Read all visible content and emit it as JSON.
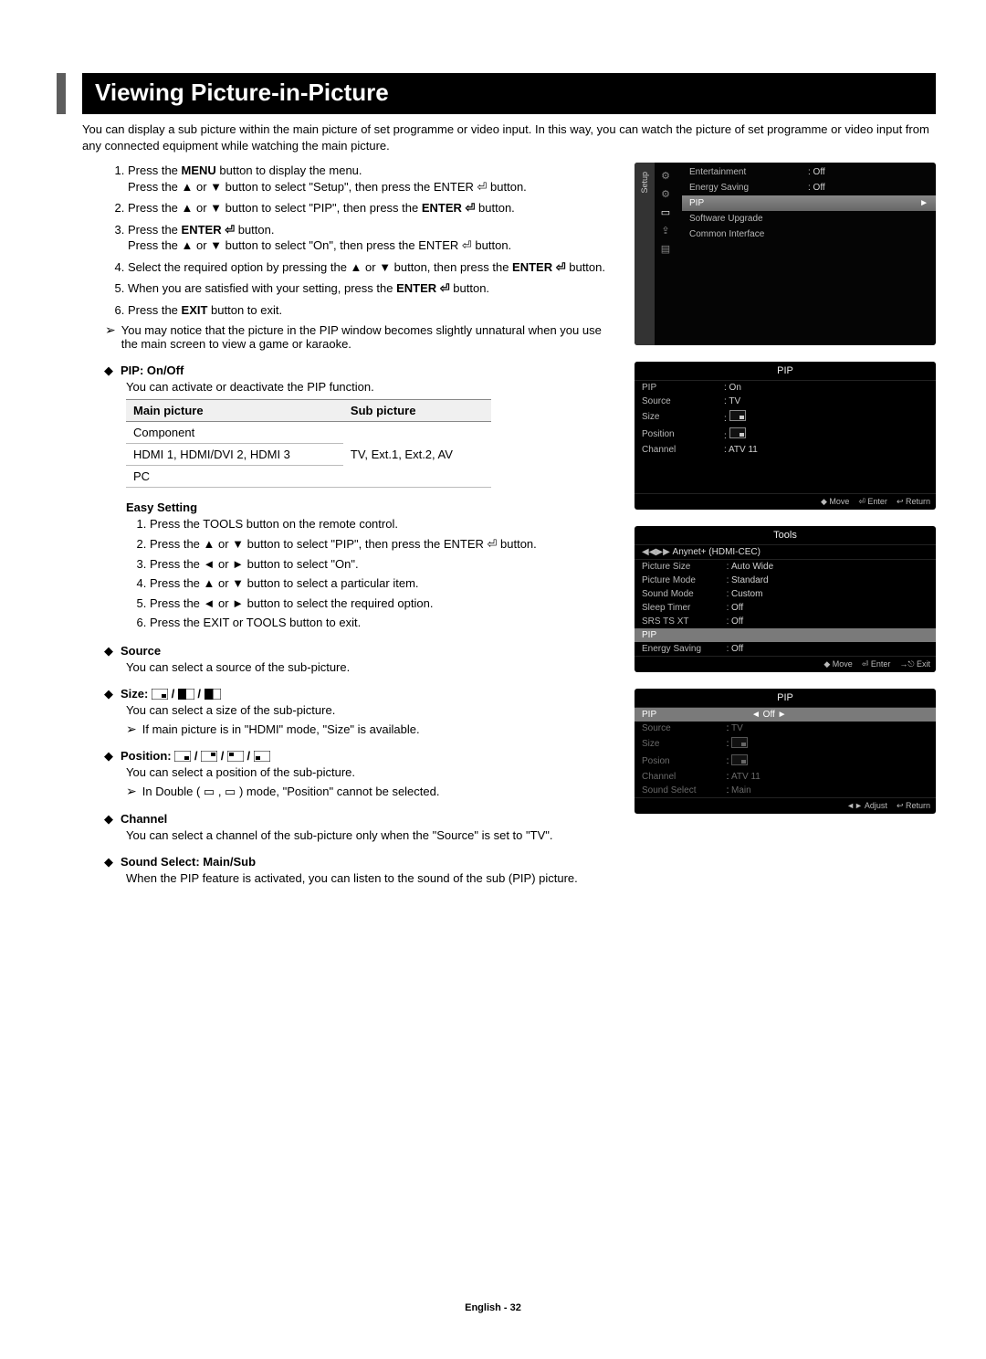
{
  "title": "Viewing Picture-in-Picture",
  "intro": "You can display a sub picture within the main picture of set programme or video input. In this way, you can watch the picture of set programme or video input from any connected equipment while watching the main picture.",
  "steps": [
    {
      "pre": "Press the ",
      "bold": "MENU",
      "post": " button to display the menu.",
      "line2": "Press the ▲ or ▼ button to select \"Setup\", then press the ENTER ⏎ button."
    },
    {
      "pre": "Press the ▲ or ▼ button to select \"PIP\", then press the ",
      "bold": "ENTER ⏎",
      "post": " button."
    },
    {
      "pre": "Press the ",
      "bold": "ENTER ⏎",
      "post": " button.",
      "line2": "Press the ▲ or ▼ button to select \"On\", then press the ENTER ⏎ button."
    },
    {
      "pre": "Select the required option by pressing the ▲ or ▼ button, then press the ",
      "bold": "ENTER ⏎",
      "post": " button."
    },
    {
      "pre": "When you are satisfied with your setting, press the ",
      "bold": "ENTER ⏎",
      "post": " button."
    },
    {
      "pre": "Press the ",
      "bold": "EXIT",
      "post": " button to exit."
    }
  ],
  "note1": "You may notice that the picture in the PIP window becomes slightly unnatural when you use the main screen to view a game or karaoke.",
  "pip_onoff": {
    "label": "PIP: On/Off",
    "desc": "You can activate or deactivate the PIP function."
  },
  "table": {
    "h1": "Main picture",
    "h2": "Sub picture",
    "r1c1": "Component",
    "r1c2": "",
    "r2c1": "HDMI 1, HDMI/DVI 2, HDMI 3",
    "r2c2": "TV, Ext.1, Ext.2, AV",
    "r3c1": "PC",
    "r3c2": ""
  },
  "easy": {
    "head": "Easy Setting",
    "steps": [
      "Press the TOOLS button on the remote control.",
      "Press the ▲ or ▼ button to select \"PIP\", then press the ENTER ⏎ button.",
      "Press the ◄ or ► button to select \"On\".",
      "Press the ▲ or ▼ button to select a particular item.",
      "Press the ◄ or ► button to select the required option.",
      "Press the EXIT or TOOLS button to exit."
    ]
  },
  "source": {
    "label": "Source",
    "desc": "You can select a source of the sub-picture."
  },
  "size": {
    "label": "Size:",
    "desc": "You can select a size of the sub-picture.",
    "note": "If main picture is in \"HDMI\" mode, \"Size\" is available."
  },
  "position": {
    "label": "Position:",
    "desc": "You can select a position of the sub-picture.",
    "note": "In Double ( ▭ , ▭ ) mode, \"Position\" cannot be selected."
  },
  "channel": {
    "label": "Channel",
    "desc": "You can select a channel of the sub-picture only when the \"Source\" is set to \"TV\"."
  },
  "sound": {
    "label": "Sound Select: Main/Sub",
    "desc": "When the PIP feature is activated, you can listen to the sound of the sub (PIP) picture."
  },
  "osd1": {
    "tab": "Setup",
    "rows": [
      {
        "k": "Entertainment",
        "v": ": Off"
      },
      {
        "k": "Energy Saving",
        "v": ": Off"
      },
      {
        "k": "PIP",
        "v": "►",
        "hl": true
      },
      {
        "k": "Software Upgrade",
        "v": ""
      },
      {
        "k": "Common Interface",
        "v": ""
      }
    ]
  },
  "osd2": {
    "title": "PIP",
    "rows": [
      {
        "k": "PIP",
        "v": ": On"
      },
      {
        "k": "Source",
        "v": ": TV"
      },
      {
        "k": "Size",
        "v": ": ▭"
      },
      {
        "k": "Position",
        "v": ": ▭"
      },
      {
        "k": "Channel",
        "v": ": ATV 11"
      }
    ],
    "bar": [
      "◆ Move",
      "⏎ Enter",
      "↩ Return"
    ]
  },
  "osd3": {
    "title": "Tools",
    "rows": [
      {
        "k": "Anynet+ (HDMI-CEC)",
        "v": ""
      },
      {
        "k": "Picture Size",
        "c": ":",
        "v": "Auto Wide"
      },
      {
        "k": "Picture Mode",
        "c": ":",
        "v": "Standard"
      },
      {
        "k": "Sound Mode",
        "c": ":",
        "v": "Custom"
      },
      {
        "k": "Sleep Timer",
        "c": ":",
        "v": "Off"
      },
      {
        "k": "SRS TS XT",
        "c": ":",
        "v": "Off"
      },
      {
        "k": "PIP",
        "v": "",
        "hl": true
      },
      {
        "k": "Energy Saving",
        "c": ":",
        "v": "Off"
      }
    ],
    "bar": [
      "◆ Move",
      "⏎ Enter",
      "→⎋ Exit"
    ]
  },
  "osd4": {
    "title": "PIP",
    "rows": [
      {
        "k": "PIP",
        "v": "◄    Off    ►",
        "hl": true
      },
      {
        "k": "Source",
        "c": ":",
        "v": "TV",
        "dim": true
      },
      {
        "k": "Size",
        "c": ":",
        "v": "▭",
        "dim": true
      },
      {
        "k": "Posion",
        "c": ":",
        "v": "▭",
        "dim": true
      },
      {
        "k": "Channel",
        "c": ":",
        "v": "ATV 11",
        "dim": true
      },
      {
        "k": "Sound Select",
        "c": ":",
        "v": "Main",
        "dim": true
      }
    ],
    "bar": [
      "◄► Adjust",
      "↩ Return"
    ]
  },
  "footer": "English - 32"
}
